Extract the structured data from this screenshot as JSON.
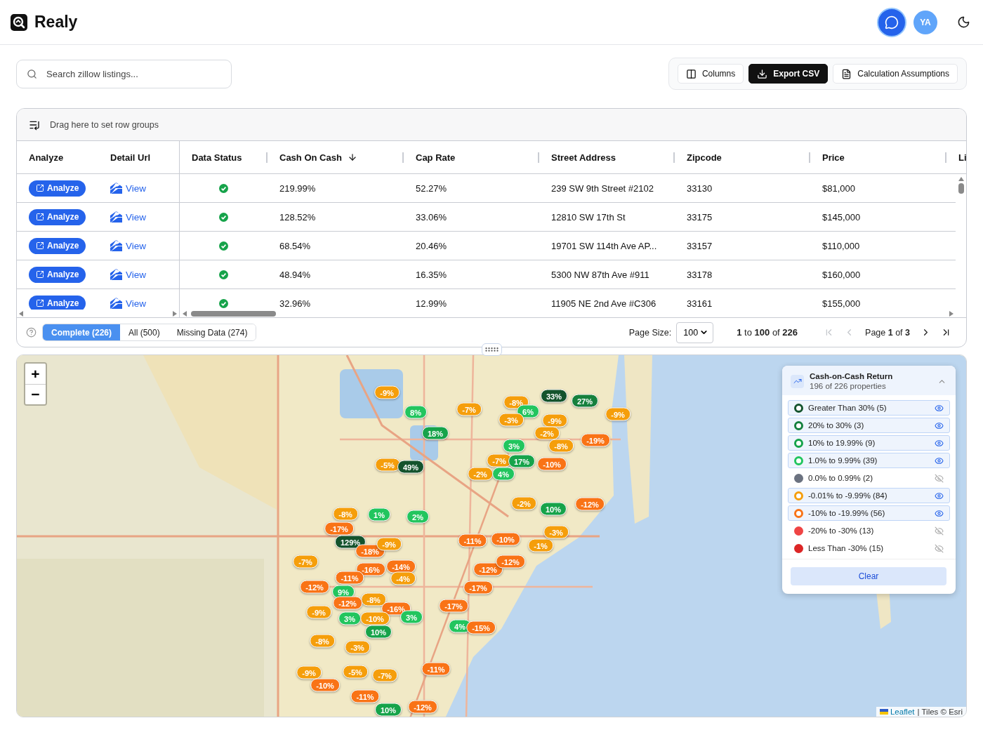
{
  "app": {
    "name": "Realy",
    "avatar": "YA"
  },
  "search": {
    "placeholder": "Search zillow listings..."
  },
  "toolbar": [
    {
      "label": "Columns",
      "kind": "columns",
      "primary": false
    },
    {
      "label": "Export CSV",
      "kind": "export",
      "primary": true
    },
    {
      "label": "Calculation Assumptions",
      "kind": "assumptions",
      "primary": false
    }
  ],
  "grid": {
    "group_hint": "Drag here to set row groups",
    "columns": [
      {
        "label": "Analyze",
        "sorted": false
      },
      {
        "label": "Detail Url",
        "sorted": false
      },
      {
        "label": "Data Status",
        "sorted": false
      },
      {
        "label": "Cash On Cash",
        "sorted": true
      },
      {
        "label": "Cap Rate",
        "sorted": false
      },
      {
        "label": "Street Address",
        "sorted": false
      },
      {
        "label": "Zipcode",
        "sorted": false
      },
      {
        "label": "Price",
        "sorted": false
      },
      {
        "label": "Li"
      }
    ],
    "rows": [
      {
        "analyze": "Analyze",
        "detail": "View",
        "complete": true,
        "cash_on_cash": "219.99%",
        "cap_rate": "52.27%",
        "address": "239 SW 9th Street #2102",
        "zipcode": "33130",
        "price": "$81,000"
      },
      {
        "analyze": "Analyze",
        "detail": "View",
        "complete": true,
        "cash_on_cash": "128.52%",
        "cap_rate": "33.06%",
        "address": "12810 SW 17th St",
        "zipcode": "33175",
        "price": "$145,000"
      },
      {
        "analyze": "Analyze",
        "detail": "View",
        "complete": true,
        "cash_on_cash": "68.54%",
        "cap_rate": "20.46%",
        "address": "19701 SW 114th Ave AP...",
        "zipcode": "33157",
        "price": "$110,000"
      },
      {
        "analyze": "Analyze",
        "detail": "View",
        "complete": true,
        "cash_on_cash": "48.94%",
        "cap_rate": "16.35%",
        "address": "5300 NW 87th Ave #911",
        "zipcode": "33178",
        "price": "$160,000"
      },
      {
        "analyze": "Analyze",
        "detail": "View",
        "complete": true,
        "cash_on_cash": "32.96%",
        "cap_rate": "12.99%",
        "address": "11905 NE 2nd Ave #C306",
        "zipcode": "33161",
        "price": "$155,000"
      }
    ],
    "filters": [
      {
        "label": "Complete (226)",
        "selected": true
      },
      {
        "label": "All (500)",
        "selected": false
      },
      {
        "label": "Missing Data (274)",
        "selected": false
      }
    ],
    "page_size_label": "Page Size:",
    "page_size": "100",
    "range": "**1** to **100** of **226**",
    "page": "Page **1** of **3**",
    "pager": [
      {
        "kind": "first",
        "disabled": true
      },
      {
        "kind": "prev",
        "disabled": true
      },
      {
        "kind": "next",
        "disabled": false
      },
      {
        "kind": "last",
        "disabled": false
      }
    ]
  },
  "map": {
    "zoom": [
      {
        "label": "+"
      },
      {
        "label": "−"
      }
    ],
    "attribution": {
      "link": "Leaflet",
      "text": "| Tiles © Esri"
    },
    "legend": {
      "title": "Cash-on-Cash Return",
      "subtitle": "196 of 226 properties",
      "expanded": true,
      "clear": "Clear",
      "items": [
        {
          "label": "Greater Than 30% (5)",
          "color": "#14532d",
          "visible": true
        },
        {
          "label": "20% to 30% (3)",
          "color": "#15803d",
          "visible": true
        },
        {
          "label": "10% to 19.99% (9)",
          "color": "#16a34a",
          "visible": true
        },
        {
          "label": "1.0% to 9.99% (39)",
          "color": "#22c55e",
          "visible": true
        },
        {
          "label": "0.0% to 0.99% (2)",
          "color": "#6b7280",
          "visible": false
        },
        {
          "label": "-0.01% to -9.99% (84)",
          "color": "#f59e0b",
          "visible": true
        },
        {
          "label": "-10% to -19.99% (56)",
          "color": "#f97316",
          "visible": true
        },
        {
          "label": "-20% to -30% (13)",
          "color": "#ef4444",
          "visible": false
        },
        {
          "label": "Less Than -30% (15)",
          "color": "#dc2626",
          "visible": false
        }
      ]
    },
    "markers": [
      {
        "label": "-9%",
        "color": "#f59e0b"
      },
      {
        "label": "8%",
        "color": "#22c55e"
      },
      {
        "label": "18%",
        "color": "#16a34a"
      },
      {
        "label": "-7%",
        "color": "#f59e0b"
      },
      {
        "label": "33%",
        "color": "#14532d"
      },
      {
        "label": "27%",
        "color": "#15803d"
      },
      {
        "label": "-8%",
        "color": "#f59e0b"
      },
      {
        "label": "6%",
        "color": "#22c55e"
      },
      {
        "label": "-3%",
        "color": "#f59e0b"
      },
      {
        "label": "-9%",
        "color": "#f59e0b"
      },
      {
        "label": "-2%",
        "color": "#f59e0b"
      },
      {
        "label": "-8%",
        "color": "#f59e0b"
      },
      {
        "label": "-9%",
        "color": "#f59e0b"
      },
      {
        "label": "-19%",
        "color": "#f97316"
      },
      {
        "label": "3%",
        "color": "#22c55e"
      },
      {
        "label": "-5%",
        "color": "#f59e0b"
      },
      {
        "label": "49%",
        "color": "#14532d"
      },
      {
        "label": "-7%",
        "color": "#f59e0b"
      },
      {
        "label": "17%",
        "color": "#16a34a"
      },
      {
        "label": "-10%",
        "color": "#f97316"
      },
      {
        "label": "-2%",
        "color": "#f59e0b"
      },
      {
        "label": "4%",
        "color": "#22c55e"
      },
      {
        "label": "-12%",
        "color": "#f97316"
      },
      {
        "label": "-2%",
        "color": "#f59e0b"
      },
      {
        "label": "10%",
        "color": "#16a34a"
      },
      {
        "label": "-8%",
        "color": "#f59e0b"
      },
      {
        "label": "1%",
        "color": "#22c55e"
      },
      {
        "label": "2%",
        "color": "#22c55e"
      },
      {
        "label": "-17%",
        "color": "#f97316"
      },
      {
        "label": "129%",
        "color": "#14532d"
      },
      {
        "label": "-18%",
        "color": "#f97316"
      },
      {
        "label": "-9%",
        "color": "#f59e0b"
      },
      {
        "label": "-11%",
        "color": "#f97316"
      },
      {
        "label": "-10%",
        "color": "#f97316"
      },
      {
        "label": "-1%",
        "color": "#f59e0b"
      },
      {
        "label": "-3%",
        "color": "#f59e0b"
      },
      {
        "label": "-7%",
        "color": "#f59e0b"
      },
      {
        "label": "-16%",
        "color": "#f97316"
      },
      {
        "label": "-14%",
        "color": "#f97316"
      },
      {
        "label": "-4%",
        "color": "#f59e0b"
      },
      {
        "label": "-12%",
        "color": "#f97316"
      },
      {
        "label": "-11%",
        "color": "#f97316"
      },
      {
        "label": "-12%",
        "color": "#f97316"
      },
      {
        "label": "-12%",
        "color": "#f97316"
      },
      {
        "label": "-17%",
        "color": "#f97316"
      },
      {
        "label": "9%",
        "color": "#22c55e"
      },
      {
        "label": "-8%",
        "color": "#f59e0b"
      },
      {
        "label": "-12%",
        "color": "#f97316"
      },
      {
        "label": "-17%",
        "color": "#f97316"
      },
      {
        "label": "-16%",
        "color": "#f97316"
      },
      {
        "label": "-9%",
        "color": "#f59e0b"
      },
      {
        "label": "3%",
        "color": "#22c55e"
      },
      {
        "label": "-10%",
        "color": "#f59e0b"
      },
      {
        "label": "3%",
        "color": "#22c55e"
      },
      {
        "label": "4%",
        "color": "#22c55e"
      },
      {
        "label": "-15%",
        "color": "#f97316"
      },
      {
        "label": "10%",
        "color": "#16a34a"
      },
      {
        "label": "-8%",
        "color": "#f59e0b"
      },
      {
        "label": "-3%",
        "color": "#f59e0b"
      },
      {
        "label": "-9%",
        "color": "#f59e0b"
      },
      {
        "label": "-5%",
        "color": "#f59e0b"
      },
      {
        "label": "-7%",
        "color": "#f59e0b"
      },
      {
        "label": "-11%",
        "color": "#f97316"
      },
      {
        "label": "-10%",
        "color": "#f97316"
      },
      {
        "label": "-11%",
        "color": "#f97316"
      },
      {
        "label": "-12%",
        "color": "#f97316"
      },
      {
        "label": "10%",
        "color": "#16a34a"
      }
    ]
  }
}
